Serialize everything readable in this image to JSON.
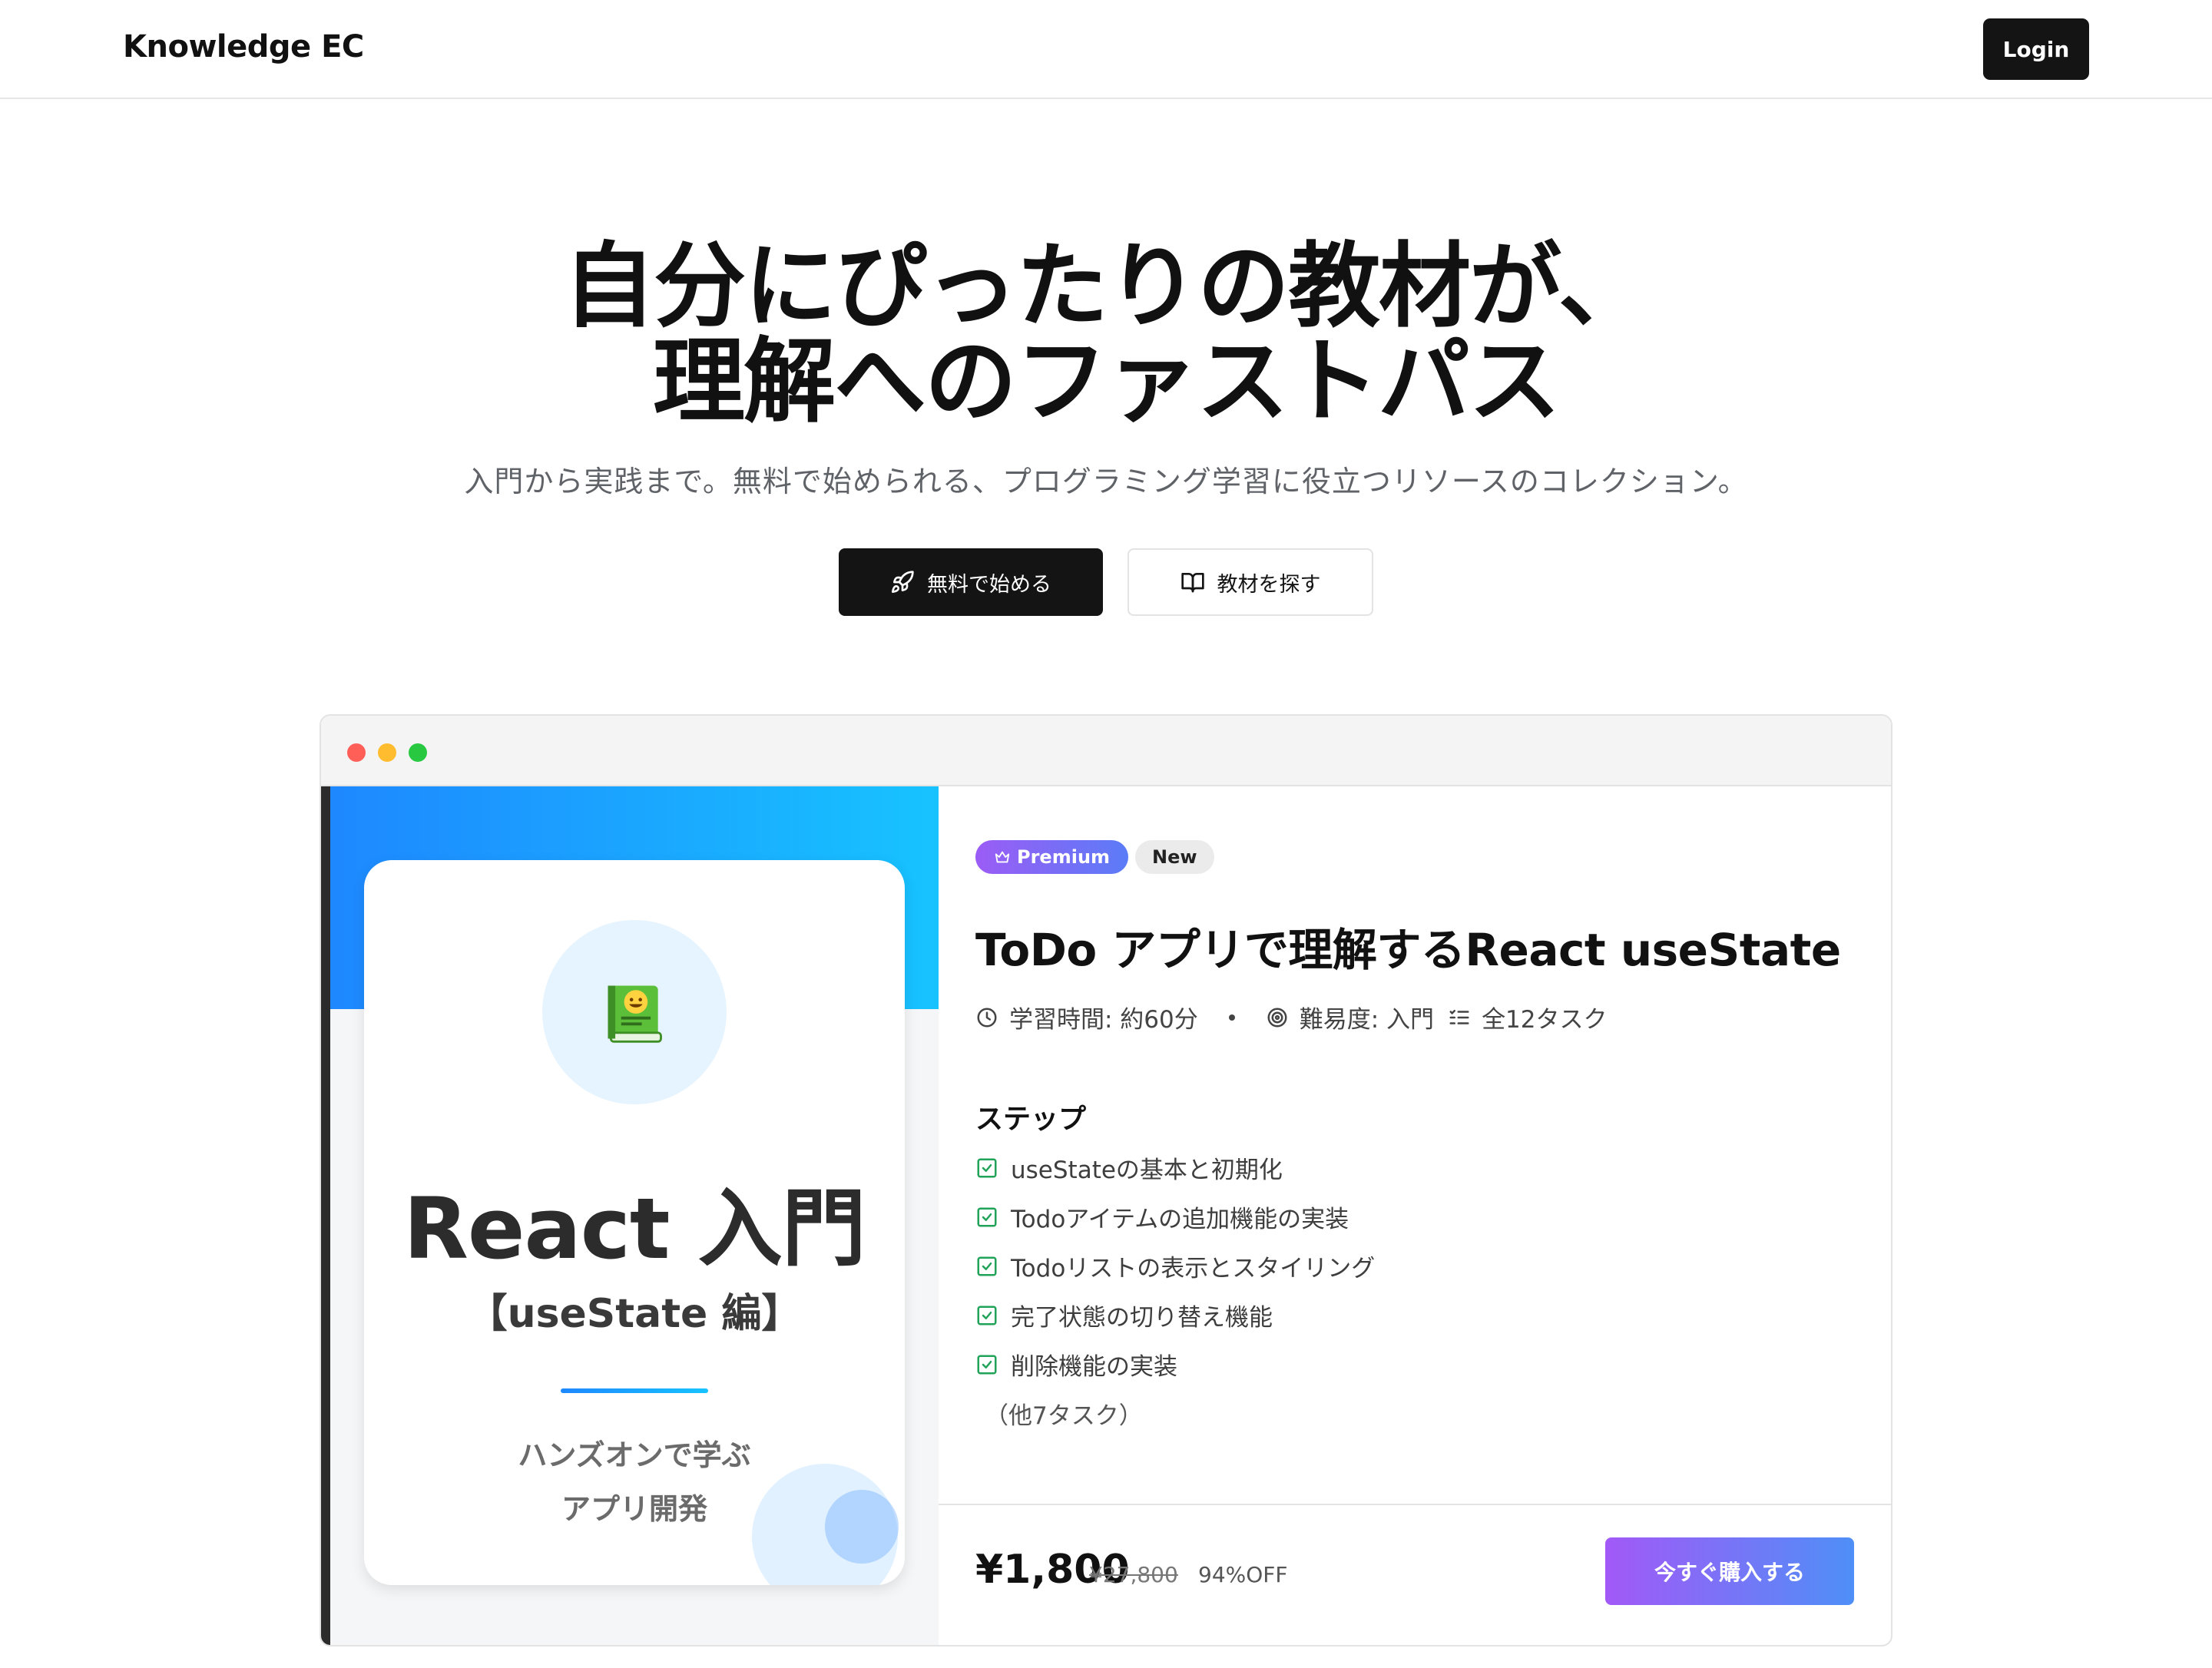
{
  "header": {
    "logo": "Knowledge EC",
    "login_label": "Login"
  },
  "hero": {
    "title_line1": "自分にぴったりの教材が、",
    "title_line2": "理解へのファストパス",
    "subtitle": "入門から実践まで。無料で始められる、プログラミング学習に役立つリソースのコレクション。",
    "primary_button": "無料で始める",
    "primary_icon": "rocket-icon",
    "secondary_button": "教材を探す",
    "secondary_icon": "open-book-icon"
  },
  "cover": {
    "icon": "book-emoji-icon",
    "title": "React 入門",
    "subtitle": "【useState 編】",
    "tagline_line1": "ハンズオンで学ぶ",
    "tagline_line2": "アプリ開発"
  },
  "course": {
    "badges": {
      "premium": "Premium",
      "premium_icon": "crown-icon",
      "new": "New"
    },
    "title": "ToDo アプリで理解するReact useState",
    "meta": {
      "duration": "学習時間: 約60分",
      "duration_icon": "clock-icon",
      "difficulty": "難易度: 入門",
      "difficulty_icon": "target-icon",
      "tasks": "全12タスク",
      "tasks_icon": "list-icon"
    },
    "steps_heading": "ステップ",
    "steps": [
      "useStateの基本と初期化",
      "Todoアイテムの追加機能の実装",
      "Todoリストの表示とスタイリング",
      "完了状態の切り替え機能",
      "削除機能の実装"
    ],
    "more_tasks": "（他7タスク）",
    "price": "¥1,800",
    "original_price": "¥27,800",
    "discount": "94%OFF",
    "buy_button": "今すぐ購入する"
  },
  "colors": {
    "primary_dark": "#141414",
    "accent_gradient_start": "#a259f7",
    "accent_gradient_end": "#4f8ff7",
    "cover_blue": "#1e88ff",
    "check_green": "#22a35a"
  }
}
